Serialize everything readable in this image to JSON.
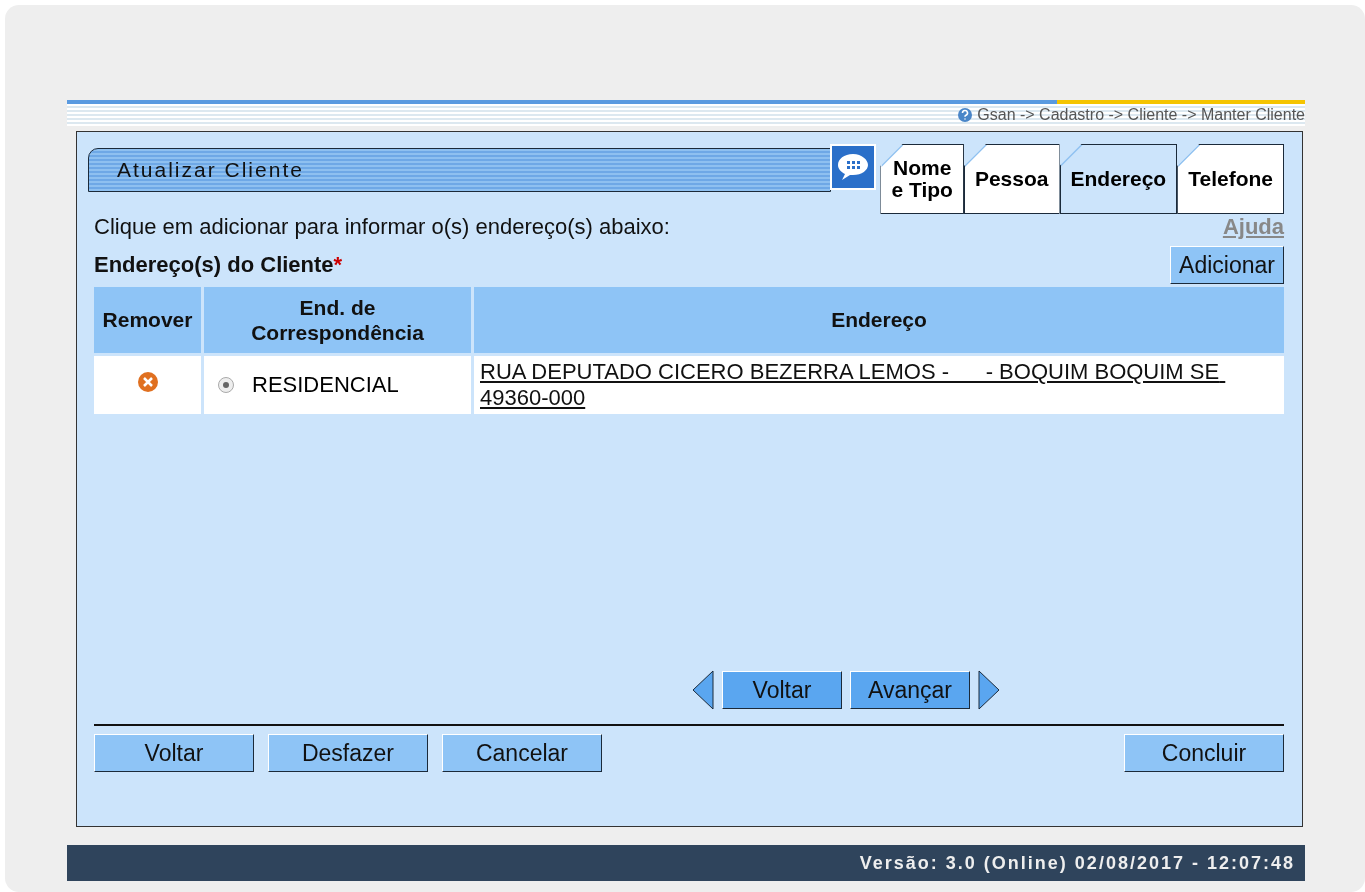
{
  "breadcrumb": "Gsan -> Cadastro -> Cliente -> Manter Cliente",
  "title": "Atualizar Cliente",
  "tabs": [
    {
      "label": "Nome\ne Tipo",
      "selected": false
    },
    {
      "label": "Pessoa",
      "selected": false
    },
    {
      "label": "Endereço",
      "selected": true
    },
    {
      "label": "Telefone",
      "selected": false
    }
  ],
  "instruction": "Clique em adicionar para informar o(s) endereço(s) abaixo:",
  "help_link": "Ajuda",
  "section_label": "Endereço(s) do Cliente",
  "required_mark": "*",
  "add_button": "Adicionar",
  "table": {
    "columns": [
      "Remover",
      "End. de\nCorrespondência",
      "Endereço"
    ],
    "rows": [
      {
        "type": "RESIDENCIAL",
        "checked": true,
        "address": "RUA DEPUTADO CICERO BEZERRA LEMOS -      - BOQUIM BOQUIM SE 49360-000"
      }
    ]
  },
  "pager": {
    "back": "Voltar",
    "next": "Avançar"
  },
  "actions": [
    "Voltar",
    "Desfazer",
    "Cancelar"
  ],
  "finish": "Concluir",
  "footer": "Versão: 3.0 (Online) 02/08/2017 - 12:07:48"
}
